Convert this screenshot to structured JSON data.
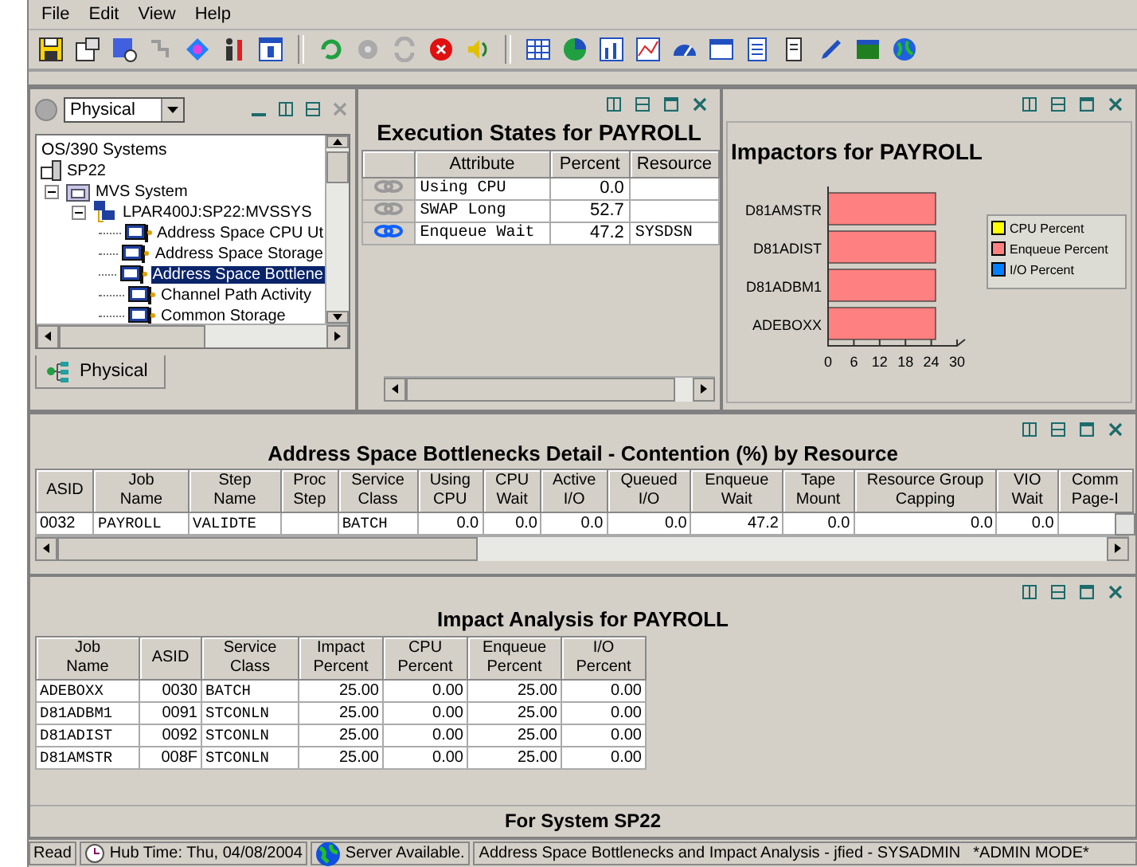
{
  "menu": [
    "File",
    "Edit",
    "View",
    "Help"
  ],
  "navigator": {
    "view": "Physical",
    "tab": "Physical",
    "tree": [
      {
        "label": "OS/390 Systems",
        "kind": "root",
        "children": [
          {
            "label": "SP22",
            "kind": "system",
            "children": [
              {
                "label": "MVS System",
                "kind": "folder",
                "expanded": true,
                "children": [
                  {
                    "label": "LPAR400J:SP22:MVSSYS",
                    "kind": "lpar",
                    "expanded": true,
                    "children": [
                      {
                        "label": "Address Space CPU Ut",
                        "kind": "workspace",
                        "selected": false
                      },
                      {
                        "label": "Address Space Storage",
                        "kind": "workspace",
                        "selected": false
                      },
                      {
                        "label": "Address Space Bottlene",
                        "kind": "workspace",
                        "selected": true
                      },
                      {
                        "label": "Channel Path Activity",
                        "kind": "workspace",
                        "selected": false
                      },
                      {
                        "label": "Common Storage",
                        "kind": "workspace",
                        "selected": false
                      }
                    ]
                  }
                ]
              }
            ]
          }
        ]
      }
    ]
  },
  "execution_states": {
    "title": "Execution States for PAYROLL",
    "columns": [
      "Attribute",
      "Percent",
      "Resource"
    ],
    "rows": [
      {
        "attribute": "Using CPU",
        "percent": "0.0",
        "active": false
      },
      {
        "attribute": "SWAP Long",
        "percent": "52.7",
        "active": false
      },
      {
        "attribute": "Enqueue Wait",
        "percent": "47.2",
        "resource": "SYSDSN",
        "active": true
      }
    ]
  },
  "impactors": {
    "title": "Impactors for PAYROLL",
    "chart_data": {
      "type": "bar",
      "orientation": "horizontal",
      "stacked": true,
      "categories": [
        "D81AMSTR",
        "D81ADIST",
        "D81ADBM1",
        "ADEBOXX"
      ],
      "series": [
        {
          "name": "CPU Percent",
          "color": "#ffff00",
          "values": [
            0,
            0,
            0,
            0
          ]
        },
        {
          "name": "Enqueue Percent",
          "color": "#ff8080",
          "values": [
            25,
            25,
            25,
            25
          ]
        },
        {
          "name": "I/O Percent",
          "color": "#0080ff",
          "values": [
            0,
            0,
            0,
            0
          ]
        }
      ],
      "xlim": [
        0,
        30
      ],
      "xticks": [
        0,
        6,
        12,
        18,
        24,
        30
      ]
    }
  },
  "detail": {
    "title": "Address Space Bottlenecks Detail - Contention (%) by Resource",
    "columns": [
      "ASID",
      "Job\nName",
      "Step\nName",
      "Proc\nStep",
      "Service\nClass",
      "Using\nCPU",
      "CPU\nWait",
      "Active\nI/O",
      "Queued\nI/O",
      "Enqueue\nWait",
      "Tape\nMount",
      "Resource Group\nCapping",
      "VIO\nWait",
      "Comm\nPage-I"
    ],
    "rows": [
      {
        "cells": [
          "0032",
          "PAYROLL",
          "VALIDTE",
          null,
          "BATCH",
          "0.0",
          "0.0",
          "0.0",
          "0.0",
          "47.2",
          "0.0",
          "0.0",
          "0.0"
        ]
      }
    ]
  },
  "impact_analysis": {
    "title": "Impact Analysis for PAYROLL",
    "columns": [
      "Job\nName",
      "ASID",
      "Service\nClass",
      "Impact\nPercent",
      "CPU\nPercent",
      "Enqueue\nPercent",
      "I/O\nPercent"
    ],
    "rows": [
      {
        "cells": [
          "ADEBOXX",
          "0030",
          "BATCH",
          "25.00",
          "0.00",
          "25.00",
          "0.00"
        ]
      },
      {
        "cells": [
          "D81ADBM1",
          "0091",
          "STCONLN",
          "25.00",
          "0.00",
          "25.00",
          "0.00"
        ]
      },
      {
        "cells": [
          "D81ADIST",
          "0092",
          "STCONLN",
          "25.00",
          "0.00",
          "25.00",
          "0.00"
        ]
      },
      {
        "cells": [
          "D81AMSTR",
          "008F",
          "STCONLN",
          "25.00",
          "0.00",
          "25.00",
          "0.00"
        ]
      }
    ],
    "footer": "For System SP22"
  },
  "status_bar": {
    "state": "Read",
    "hub_time": "Hub Time: Thu, 04/08/2004",
    "server": "Server Available.",
    "workspace": "Address Space Bottlenecks and Impact Analysis - jfied - SYSADMIN",
    "mode": "*ADMIN MODE*"
  }
}
